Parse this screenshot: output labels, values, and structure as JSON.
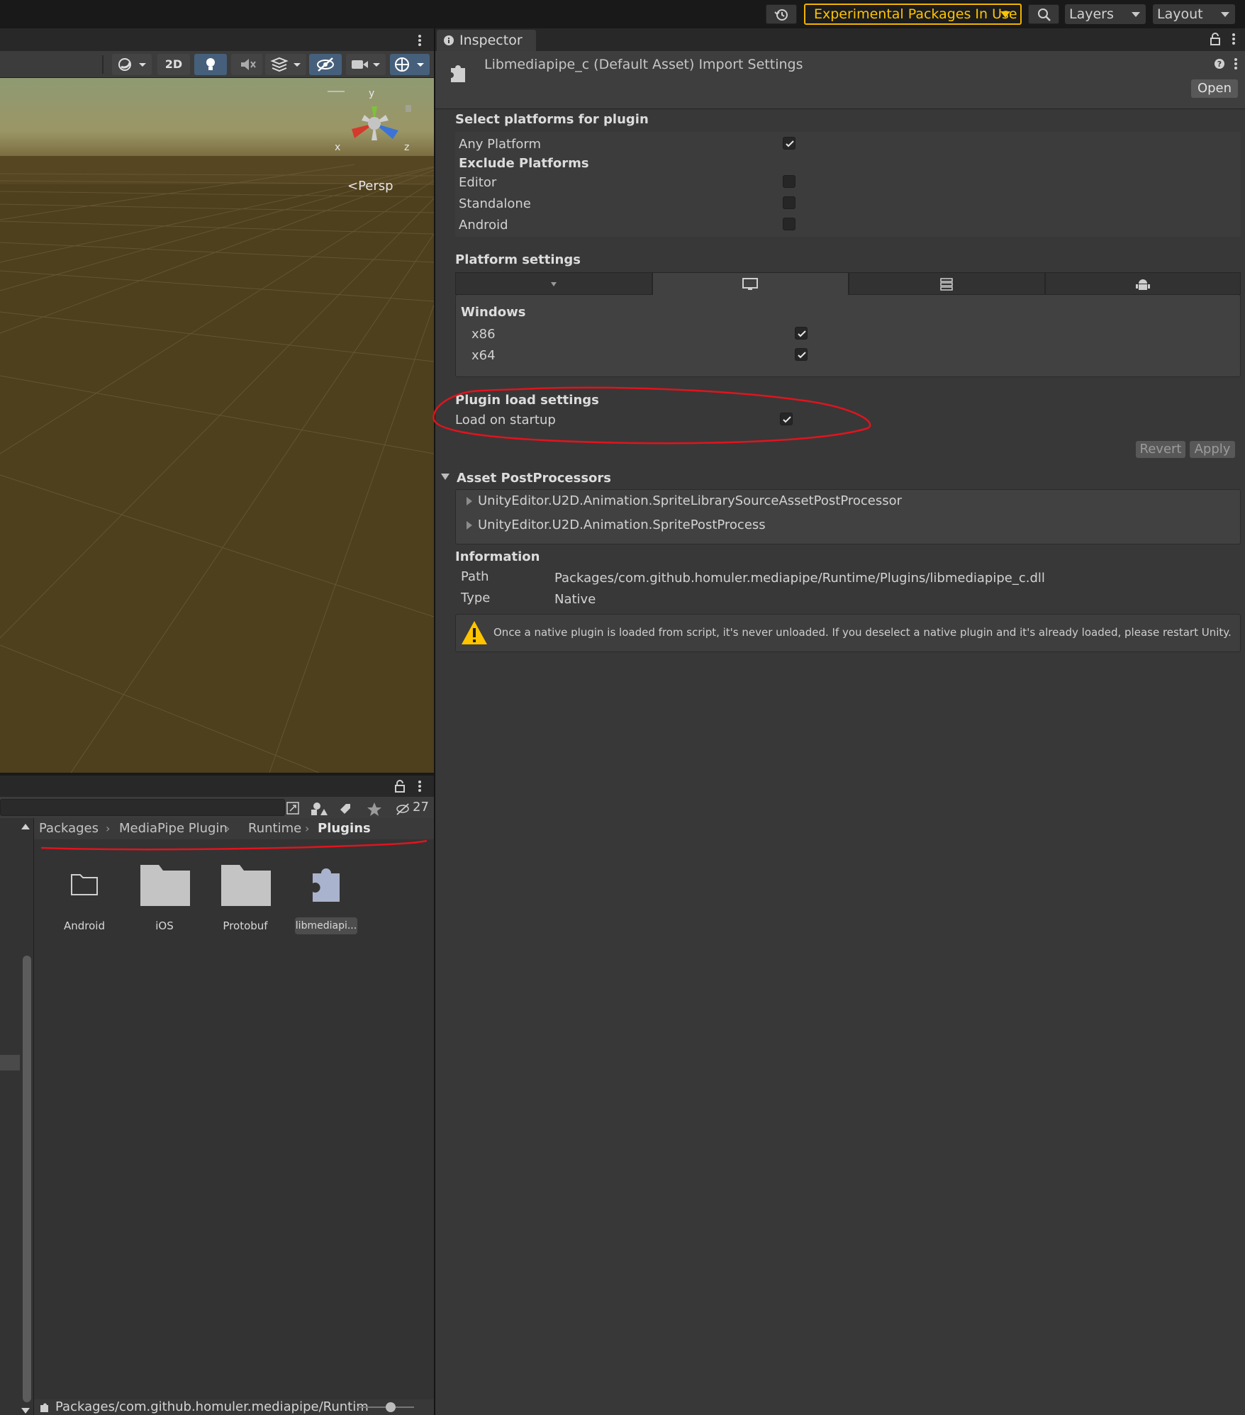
{
  "topbar": {
    "experimental_label": "Experimental Packages In Use",
    "layers_label": "Layers",
    "layout_label": "Layout"
  },
  "scene": {
    "toolbar": {
      "mode_2d": "2D"
    },
    "gizmo": {
      "y": "y",
      "x": "x",
      "z": "z",
      "projection": "Persp"
    }
  },
  "project": {
    "hidden_count": "27",
    "breadcrumb": [
      "Packages",
      "MediaPipe Plugin",
      "Runtime",
      "Plugins"
    ],
    "assets": [
      {
        "name": "Android"
      },
      {
        "name": "iOS"
      },
      {
        "name": "Protobuf"
      },
      {
        "name": "libmediapi..."
      }
    ],
    "status_path": "Packages/com.github.homuler.mediapipe/Runtim"
  },
  "inspector": {
    "tab_label": "Inspector",
    "title": "Libmediapipe_c (Default Asset) Import Settings",
    "open_button": "Open",
    "select_platforms": {
      "heading": "Select platforms for plugin",
      "any_platform": {
        "label": "Any Platform",
        "checked": true
      },
      "exclude_heading": "Exclude Platforms",
      "excludes": [
        {
          "label": "Editor",
          "checked": false
        },
        {
          "label": "Standalone",
          "checked": false
        },
        {
          "label": "Android",
          "checked": false
        }
      ]
    },
    "platform_settings": {
      "heading": "Platform settings",
      "active_tab": "windows",
      "os_heading": "Windows",
      "archs": [
        {
          "label": "x86",
          "checked": true
        },
        {
          "label": "x64",
          "checked": true
        }
      ]
    },
    "plugin_load": {
      "heading": "Plugin load settings",
      "load_on_startup": {
        "label": "Load on startup",
        "checked": true
      }
    },
    "revert_button": "Revert",
    "apply_button": "Apply",
    "postprocessors": {
      "heading": "Asset PostProcessors",
      "items": [
        "UnityEditor.U2D.Animation.SpriteLibrarySourceAssetPostProcessor",
        "UnityEditor.U2D.Animation.SpritePostProcess"
      ]
    },
    "information": {
      "heading": "Information",
      "path_label": "Path",
      "path_value": "Packages/com.github.homuler.mediapipe/Runtime/Plugins/libmediapipe_c.dll",
      "type_label": "Type",
      "type_value": "Native"
    },
    "warning": "Once a native plugin is loaded from script, it's never unloaded. If you deselect a native plugin and it's already loaded, please restart Unity."
  },
  "colors": {
    "accent_warning": "#ffc400",
    "annotation_red": "#e0141e",
    "selected_tool": "#46607c"
  }
}
